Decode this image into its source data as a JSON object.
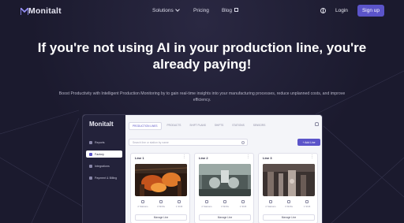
{
  "nav": {
    "brand": "Monitalt",
    "links": [
      {
        "label": "Solutions"
      },
      {
        "label": "Pricing"
      },
      {
        "label": "Blog"
      }
    ],
    "login": "Login",
    "signup": "Sign up"
  },
  "hero": {
    "title": "If you're not using AI in your production line, you're already paying!",
    "subtitle": "Boost Productivity with Intelligent Production Monitoring by to gain real-time insights into your manufacturing processes, reduce unplanned costs, and improve efficiency."
  },
  "app": {
    "brand": "Monitalt",
    "sidebar": [
      {
        "label": "Reports"
      },
      {
        "label": "Factory"
      },
      {
        "label": "Integrations"
      },
      {
        "label": "Payment & Billing"
      }
    ],
    "tabs": [
      "PRODUCTION LINES",
      "PRODUCTS",
      "SHIFT PLANS",
      "SHIFTS",
      "STATIONS",
      "SENSORS"
    ],
    "search_placeholder": "Search line or station by name",
    "add_line": "+ Add Line",
    "cards": [
      {
        "title": "Line 1",
        "stats": [
          "2 Stations",
          "3 Shifts",
          "1 Shift"
        ],
        "manage": "Manage Line"
      },
      {
        "title": "Line 2",
        "stats": [
          "2 Stations",
          "3 Shifts",
          "1 Shift"
        ],
        "manage": "Manage Line"
      },
      {
        "title": "Line 3",
        "stats": [
          "2 Stations",
          "3 Shifts",
          "1 Shift"
        ],
        "manage": "Manage Line"
      }
    ]
  },
  "colors": {
    "accent": "#5b54c9",
    "background": "#1b1a2e",
    "sidebar": "#23223a"
  }
}
